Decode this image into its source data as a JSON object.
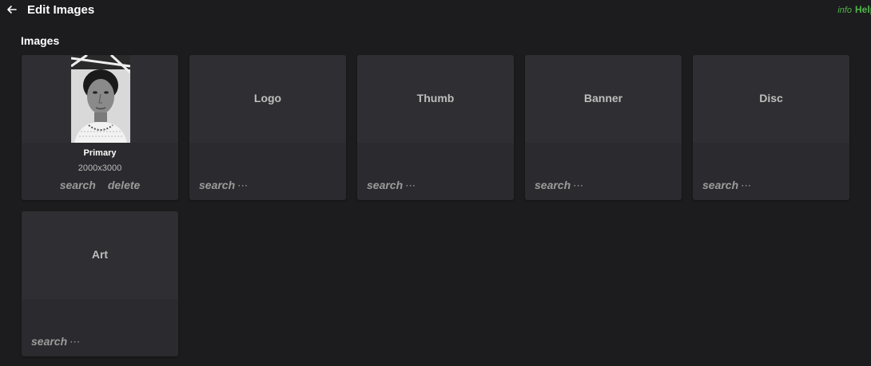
{
  "header": {
    "title": "Edit Images",
    "back_icon": "arrow-left-icon",
    "info_label": "info",
    "help_label": "Help",
    "accent_color": "#52b54b"
  },
  "section": {
    "title": "Images"
  },
  "primary": {
    "label": "Primary",
    "dimensions": "2000x3000",
    "search_label": "search",
    "delete_label": "delete"
  },
  "cards": [
    {
      "label": "Logo",
      "search_label": "search",
      "more_label": "⋯"
    },
    {
      "label": "Thumb",
      "search_label": "search",
      "more_label": "⋯"
    },
    {
      "label": "Banner",
      "search_label": "search",
      "more_label": "⋯"
    },
    {
      "label": "Disc",
      "search_label": "search",
      "more_label": "⋯"
    },
    {
      "label": "Art",
      "search_label": "search",
      "more_label": "⋯"
    }
  ]
}
